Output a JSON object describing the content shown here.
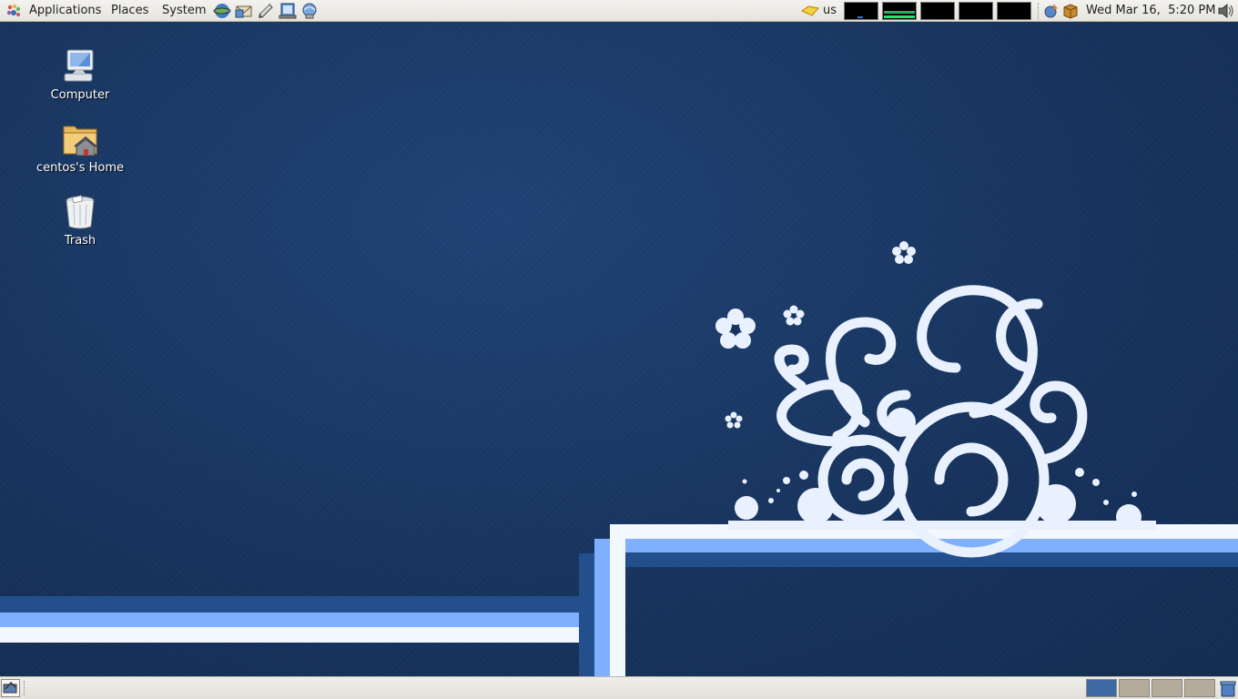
{
  "top_panel": {
    "menus": [
      {
        "label": "Applications"
      },
      {
        "label": "Places"
      },
      {
        "label": "System"
      }
    ],
    "launchers": [
      "web-browser-icon",
      "email-client-icon",
      "text-editor-icon",
      "document-viewer-icon",
      "network-icon"
    ],
    "keyboard_layout": "us",
    "clock": "Wed Mar 16,  5:20 PM"
  },
  "desktop": {
    "icons": [
      {
        "label": "Computer",
        "icon": "computer-icon"
      },
      {
        "label": "centos's Home",
        "icon": "home-folder-icon"
      },
      {
        "label": "Trash",
        "icon": "trash-icon"
      }
    ]
  },
  "bottom_panel": {
    "workspaces": [
      {
        "active": true,
        "color": "#3d6aa3"
      },
      {
        "active": false,
        "color": "#b5ab9a"
      },
      {
        "active": false,
        "color": "#b5ab9a"
      },
      {
        "active": false,
        "color": "#b5ab9a"
      }
    ]
  },
  "colors": {
    "desktop_bg": "#17335d",
    "panel_bg": "#ebe9e3",
    "accent_blue": "#7fb0ff",
    "swirl": "#e9f1ff"
  }
}
